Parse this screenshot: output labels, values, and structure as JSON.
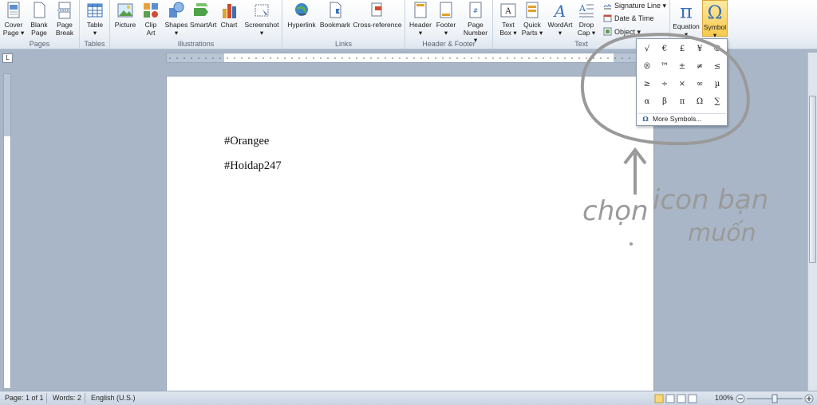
{
  "ribbon": {
    "groups": {
      "pages": "Pages",
      "tables": "Tables",
      "illustrations": "Illustrations",
      "links": "Links",
      "header_footer": "Header & Footer",
      "text": "Text"
    },
    "buttons": {
      "cover_page": [
        "Cover",
        "Page ▾"
      ],
      "blank_page": [
        "Blank",
        "Page"
      ],
      "page_break": [
        "Page",
        "Break"
      ],
      "table": [
        "Table",
        "▾"
      ],
      "picture": [
        "Picture",
        ""
      ],
      "clip_art": [
        "Clip",
        "Art"
      ],
      "shapes": [
        "Shapes",
        "▾"
      ],
      "smartart": [
        "SmartArt",
        ""
      ],
      "chart": [
        "Chart",
        ""
      ],
      "screenshot": [
        "Screenshot",
        "▾"
      ],
      "hyperlink": [
        "Hyperlink",
        ""
      ],
      "bookmark": [
        "Bookmark",
        ""
      ],
      "cross_reference": [
        "Cross-reference",
        ""
      ],
      "header": [
        "Header",
        "▾"
      ],
      "footer": [
        "Footer",
        "▾"
      ],
      "page_number": [
        "Page",
        "Number ▾"
      ],
      "text_box": [
        "Text",
        "Box ▾"
      ],
      "quick_parts": [
        "Quick",
        "Parts ▾"
      ],
      "wordart": [
        "WordArt",
        "▾"
      ],
      "drop_cap": [
        "Drop",
        "Cap ▾"
      ],
      "equation": [
        "Equation",
        "▾"
      ],
      "symbol": [
        "Symbol",
        "▾"
      ]
    },
    "small": {
      "signature_line": "Signature Line ▾",
      "date_time": "Date & Time",
      "object": "Object ▾"
    }
  },
  "document": {
    "lines": [
      "#Orangee",
      "#Hoidap247"
    ]
  },
  "symbol_dropdown": {
    "symbols": [
      "√",
      "€",
      "£",
      "¥",
      "©",
      "®",
      "™",
      "±",
      "≠",
      "≤",
      "≥",
      "÷",
      "×",
      "∞",
      "µ",
      "α",
      "β",
      "π",
      "Ω",
      "∑"
    ],
    "more_symbols": "More Symbols..."
  },
  "annotation": {
    "text_1": "chọn",
    "text_2": "icon bạn",
    "text_3": "muốn"
  },
  "status": {
    "page": "Page: 1 of 1",
    "words": "Words: 2",
    "language": "English (U.S.)",
    "zoom": "100%"
  },
  "colors": {
    "ribbon_top": "#ffffff",
    "background": "#a9b6c7",
    "highlight": "#f7c94e",
    "annotation": "#9a9a9a"
  }
}
